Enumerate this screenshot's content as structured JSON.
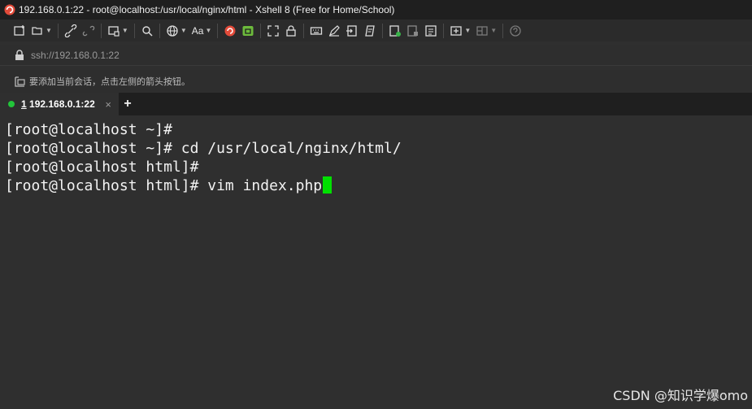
{
  "window": {
    "title": "192.168.0.1:22 - root@localhost:/usr/local/nginx/html - Xshell 8 (Free for Home/School)"
  },
  "toolbar": {
    "font_button": "Aa",
    "icons": [
      "new-session-icon",
      "open-icon",
      "reconnect-icon",
      "disconnect-icon",
      "properties-icon",
      "find-icon",
      "encoding-icon",
      "font-icon",
      "xshell-icon",
      "xftp-icon",
      "fullscreen-icon",
      "lock-icon",
      "keyboard-icon",
      "compose-icon",
      "transfer-icon",
      "script-icon",
      "log-icon",
      "print-icon",
      "tile-icon",
      "layout-icon",
      "help-icon"
    ]
  },
  "address": {
    "value": "ssh://192.168.0.1:22"
  },
  "hint": {
    "text": "要添加当前会话，点击左侧的箭头按钮。"
  },
  "tabs": [
    {
      "number": "1",
      "label": "192.168.0.1:22",
      "close": "×",
      "status_color": "#22c43a"
    }
  ],
  "add_tab": "+",
  "terminal": {
    "lines": [
      "[root@localhost ~]#",
      "[root@localhost ~]# cd /usr/local/nginx/html/",
      "[root@localhost html]#",
      "[root@localhost html]# vim index.php"
    ],
    "cursor_color": "#00e000"
  },
  "watermark": "CSDN @知识学爆omo"
}
